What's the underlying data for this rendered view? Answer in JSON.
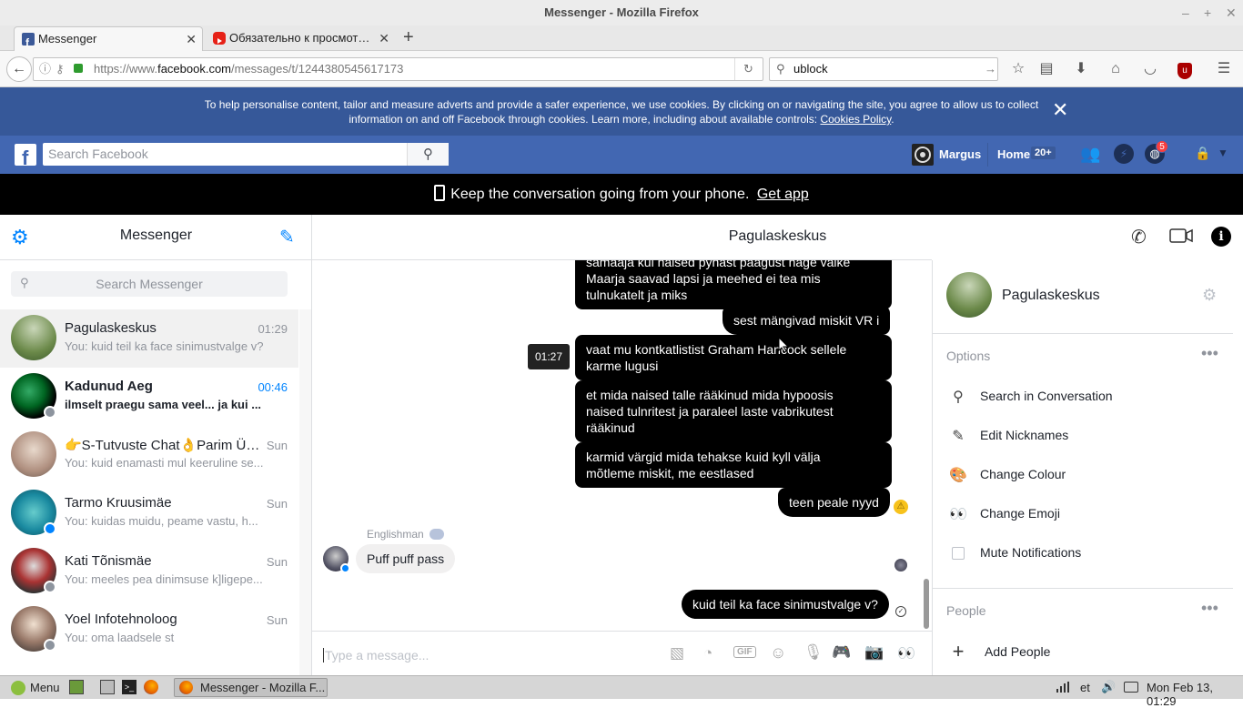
{
  "window": {
    "title": "Messenger - Mozilla Firefox"
  },
  "tabs": [
    {
      "label": "Messenger",
      "active": true
    },
    {
      "label": "Обязательно к просмот…",
      "active": false
    }
  ],
  "nav": {
    "url_prefix": "https://www.",
    "url_domain": "facebook.com",
    "url_path": "/messages/t/1244380545617173",
    "search_value": "ublock"
  },
  "cookie_banner": {
    "line1": "To help personalise content, tailor and measure adverts and provide a safer experience, we use cookies. By clicking on or navigating the site, you agree to allow us to collect",
    "line2": "information on and off Facebook through cookies. Learn more, including about available controls: ",
    "link": "Cookies Policy",
    "end": "."
  },
  "fb_header": {
    "search_placeholder": "Search Facebook",
    "user_name": "Margus",
    "home_label": "Home",
    "home_badge": "20+",
    "notif_badge": "5"
  },
  "app_bar": {
    "text": "Keep the conversation going from your phone.",
    "link": "Get app"
  },
  "left": {
    "title": "Messenger",
    "search_placeholder": "Search Messenger",
    "conversations": [
      {
        "name": "Pagulaskeskus",
        "time": "01:29",
        "preview": "You: kuid teil ka face sinimustvalge v?",
        "selected": true,
        "unread": false
      },
      {
        "name": "Kadunud Aeg",
        "time": "00:46",
        "preview": "ilmselt praegu sama veel... ja kui ...",
        "selected": false,
        "unread": true
      },
      {
        "name": "👉S-Tutvuste Chat👌Parim Ül...",
        "time": "Sun",
        "preview": "You: kuid enamasti mul keeruline se...",
        "selected": false,
        "unread": false
      },
      {
        "name": "Tarmo Kruusimäe",
        "time": "Sun",
        "preview": "You: kuidas muidu, peame vastu, h...",
        "selected": false,
        "unread": false
      },
      {
        "name": "Kati Tõnismäe",
        "time": "Sun",
        "preview": "You: meeles pea dinimsuse k]ligepe...",
        "selected": false,
        "unread": false
      },
      {
        "name": "Yoel Infotehnoloog",
        "time": "Sun",
        "preview": "You: oma laadsele st",
        "selected": false,
        "unread": false
      }
    ]
  },
  "chat": {
    "title": "Pagulaskeskus",
    "messages": [
      {
        "line1": "samaaja kui naised pyhast paagust nage valke",
        "line2": "Maarja saavad lapsi ja meehed ei tea mis",
        "line3": "tulnukatelt ja miks"
      },
      {
        "text": "sest mängivad miskit VR i"
      },
      {
        "line1": "vaat mu kontkatlistist Graham Hancock sellele",
        "line2": "karme lugusi"
      },
      {
        "line1": "et mida naised talle rääkinud mida hypoosis",
        "line2": "naised tulnritest ja paraleel laste vabrikutest",
        "line3": "rääkinud"
      },
      {
        "line1": "karmid värgid mida tehakse kuid kyll välja",
        "line2": "mõtleme miskit, me eestlased"
      },
      {
        "text": "teen peale nyyd"
      },
      {
        "text": "kuid teil ka face sinimustvalge v?"
      }
    ],
    "tooltip": "01:27",
    "incoming_sender": "Englishman",
    "incoming_text": "Puff puff pass",
    "composer_placeholder": "Type a message..."
  },
  "right": {
    "name": "Pagulaskeskus",
    "options_header": "Options",
    "options": [
      {
        "label": "Search in Conversation",
        "icon": "search-icon"
      },
      {
        "label": "Edit Nicknames",
        "icon": "pencil-icon"
      },
      {
        "label": "Change Colour",
        "icon": "palette-icon"
      },
      {
        "label": "Change Emoji",
        "icon": "eyes-icon"
      },
      {
        "label": "Mute Notifications",
        "icon": "checkbox-icon"
      }
    ],
    "people_header": "People",
    "add_people": "Add People"
  },
  "taskbar": {
    "menu": "Menu",
    "window": "Messenger - Mozilla F...",
    "lang": "et",
    "clock": "Mon Feb 13, 01:29"
  }
}
